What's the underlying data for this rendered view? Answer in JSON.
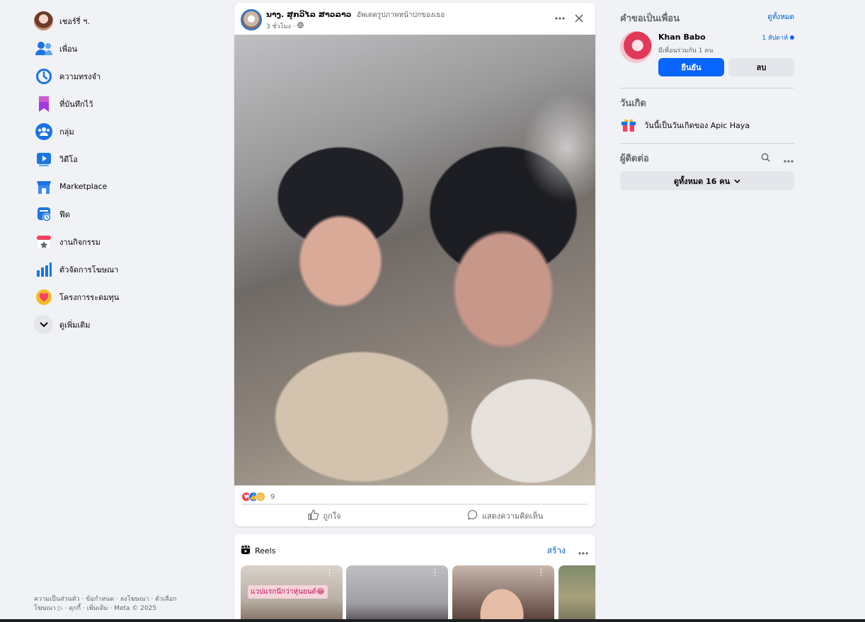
{
  "left_nav": {
    "items": [
      {
        "label": "เชอร์รี่ ฯ.",
        "icon": "profile-avatar"
      },
      {
        "label": "เพื่อน",
        "icon": "friends-icon"
      },
      {
        "label": "ความทรงจำ",
        "icon": "memories-icon"
      },
      {
        "label": "ที่บันทึกไว้",
        "icon": "saved-icon"
      },
      {
        "label": "กลุ่ม",
        "icon": "groups-icon"
      },
      {
        "label": "วิดีโอ",
        "icon": "video-icon"
      },
      {
        "label": "Marketplace",
        "icon": "marketplace-icon"
      },
      {
        "label": "ฟีด",
        "icon": "feeds-icon"
      },
      {
        "label": "งานกิจกรรม",
        "icon": "events-icon"
      },
      {
        "label": "ตัวจัดการโฆษณา",
        "icon": "ads-manager-icon"
      },
      {
        "label": "โครงการระดมทุน",
        "icon": "fundraisers-icon"
      },
      {
        "label": "ดูเพิ่มเติม",
        "icon": "chevron-down-icon"
      }
    ]
  },
  "footer": {
    "line1": "ความเป็นส่วนตัว · ข้อกำหนด · ลงโฆษณา · ตัวเลือก",
    "line2": "โฆษณา ▷ · คุกกี้ · เพิ่มเติม · Meta © 2025"
  },
  "post": {
    "author": "ນາງ. ສຸກວິໄລ ສາວລາວ",
    "action": "อัพเดตรูปภาพหน้าปกของเธอ",
    "time": "3 ชั่วโมง ·",
    "reaction_count": "9",
    "like_label": "ถูกใจ",
    "comment_label": "แสดงความคิดเห็น"
  },
  "reels": {
    "title": "Reels",
    "create_label": "สร้าง",
    "first_caption": "แวปแรกนึกว่าหุ่นยนต์😂"
  },
  "friend_requests": {
    "title": "คำขอเป็นเพื่อน",
    "see_all": "ดูทั้งหมด",
    "name": "Khan Babo",
    "time": "1 สัปดาห์",
    "mutual": "มีเพื่อนร่วมกัน 1 คน",
    "confirm_label": "ยืนยัน",
    "delete_label": "ลบ"
  },
  "birthdays": {
    "title": "วันเกิด",
    "text": "วันนี้เป็นวันเกิดของ Apic Haya"
  },
  "contacts": {
    "title": "ผู้ติดต่อ",
    "see_all_label": "ดูทั้งหมด 16 คน"
  },
  "colors": {
    "accent": "#0866ff",
    "link": "#0064d1",
    "background": "#f0f2f5",
    "secondary_text": "#65676b"
  }
}
